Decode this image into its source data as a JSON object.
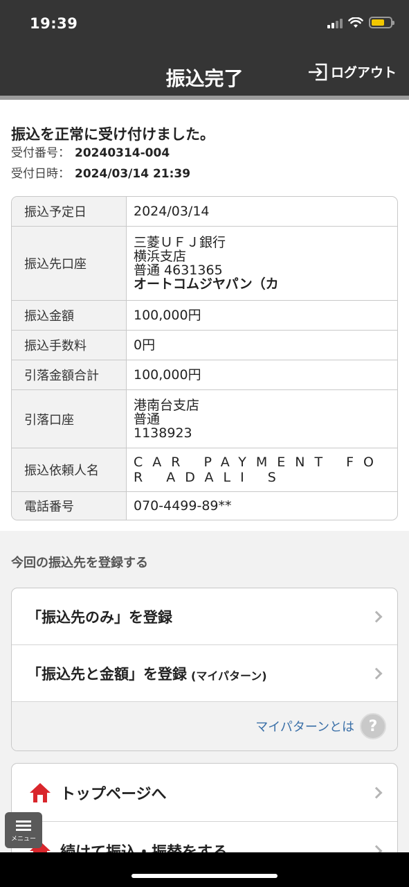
{
  "status_bar": {
    "time": "19:39"
  },
  "header": {
    "title": "振込完了",
    "logout_label": "ログアウト"
  },
  "result": {
    "message": "振込を正常に受け付けました。",
    "receipt_no_label": "受付番号：",
    "receipt_no": "20240314-004",
    "receipt_time_label": "受付日時：",
    "receipt_time": "2024/03/14 21:39"
  },
  "details": {
    "scheduled_date": {
      "label": "振込予定日",
      "value": "2024/03/14"
    },
    "payee_account": {
      "label": "振込先口座",
      "bank": "三菱ＵＦＪ銀行",
      "branch": "横浜支店",
      "account": "普通 4631365",
      "name": "オートコムジヤパン（カ"
    },
    "amount": {
      "label": "振込金額",
      "value": "100,000円"
    },
    "fee": {
      "label": "振込手数料",
      "value": "0円"
    },
    "total": {
      "label": "引落金額合計",
      "value": "100,000円"
    },
    "debit_account": {
      "label": "引落口座",
      "branch": "港南台支店",
      "type": "普通",
      "number": "1138923"
    },
    "requester": {
      "label": "振込依頼人名",
      "value": "CAR PAYMENT FOR ADALI S"
    },
    "phone": {
      "label": "電話番号",
      "value": "070-4499-89**"
    }
  },
  "register": {
    "section_label": "今回の振込先を登録する",
    "payee_only": "「振込先のみ」を登録",
    "payee_amount": "「振込先と金額」を登録",
    "payee_amount_sub": "(マイパターン)",
    "help_link": "マイパターンとは",
    "help_icon": "?"
  },
  "nav": {
    "top_page": "トップページへ",
    "continue": "続けて振込・振替をする"
  },
  "menu": {
    "label": "メニュー"
  },
  "icons": [
    "logout-icon",
    "signal-icon",
    "wifi-icon",
    "battery-icon",
    "chevron-right-icon",
    "help-icon",
    "home-icon",
    "menu-icon"
  ],
  "colors": {
    "header": "#353535",
    "link": "#3b70a8",
    "home_icon": "#d9262c",
    "battery": "#f2c700"
  }
}
